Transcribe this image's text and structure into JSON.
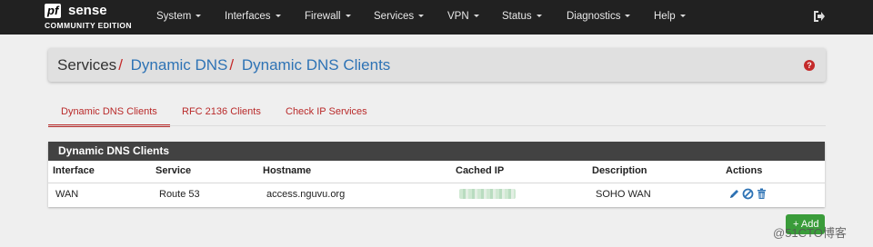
{
  "nav": {
    "logo_pf": "pf",
    "logo_sense": "sense",
    "logo_edition": "COMMUNITY EDITION",
    "menu": [
      {
        "label": "System"
      },
      {
        "label": "Interfaces"
      },
      {
        "label": "Firewall"
      },
      {
        "label": "Services"
      },
      {
        "label": "VPN"
      },
      {
        "label": "Status"
      },
      {
        "label": "Diagnostics"
      },
      {
        "label": "Help"
      }
    ],
    "logout_icon": "logout-icon"
  },
  "breadcrumb": {
    "root": "Services",
    "separator": "/",
    "level1": "Dynamic DNS",
    "level2": "Dynamic DNS Clients",
    "help_symbol": "?"
  },
  "tabs": [
    {
      "label": "Dynamic DNS Clients",
      "active": true
    },
    {
      "label": "RFC 2136 Clients",
      "active": false
    },
    {
      "label": "Check IP Services",
      "active": false
    }
  ],
  "table": {
    "title": "Dynamic DNS Clients",
    "headers": [
      "Interface",
      "Service",
      "Hostname",
      "Cached IP",
      "Description",
      "Actions"
    ],
    "rows": [
      {
        "interface": "WAN",
        "service": "Route 53",
        "hostname": "access.nguvu.org",
        "cached_ip": "",
        "description": "SOHO WAN",
        "actions": [
          "edit-icon",
          "disable-icon",
          "delete-icon"
        ]
      }
    ]
  },
  "add_button": {
    "label": "Add"
  },
  "watermark": "@51CTO博客",
  "colors": {
    "navbar": "#212121",
    "accent_red": "#b92a2a",
    "link_blue": "#2e73b5",
    "panel_header": "#424242",
    "add_green": "#3a9c3a"
  }
}
